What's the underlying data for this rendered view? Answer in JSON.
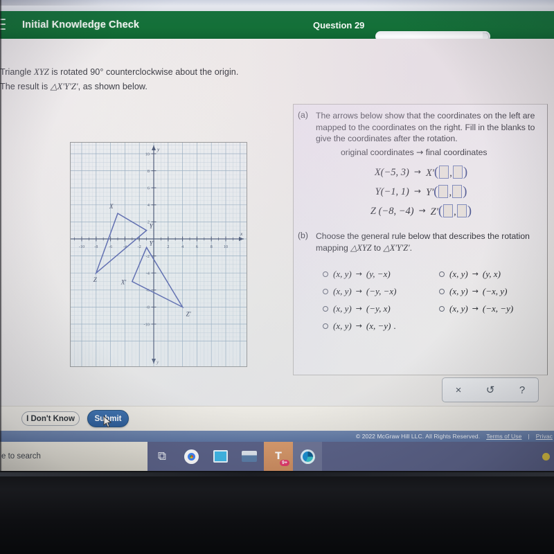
{
  "header": {
    "menu_icon": "hamburger-icon",
    "title": "Initial Knowledge Check",
    "question_label": "Question 29",
    "progress_percent": 97,
    "brand_green": "#147038"
  },
  "prompt": {
    "line1_a": "Triangle ",
    "line1_math": "XYZ",
    "line1_b": " is rotated 90° counterclockwise about the origin.",
    "line2_a": "The result is ",
    "line2_math": "△X'Y'Z'",
    "line2_b": ", as shown below."
  },
  "graph": {
    "x_ticks": [
      -10,
      -8,
      -6,
      -4,
      -2,
      2,
      4,
      6,
      8,
      10
    ],
    "y_ticks": [
      10,
      8,
      6,
      4,
      2,
      -2,
      -4,
      -6,
      -8,
      -10
    ],
    "x_axis_label": "x",
    "y_axis_label": "y",
    "grid": true,
    "axis_range_x": [
      -11.5,
      11.5
    ],
    "axis_range_y": [
      -11.5,
      11.5
    ],
    "preimage": {
      "name": "XYZ",
      "points": [
        {
          "label": "X",
          "x": -5,
          "y": 3
        },
        {
          "label": "Y",
          "x": -1,
          "y": 1
        },
        {
          "label": "Z",
          "x": -8,
          "y": -4
        }
      ]
    },
    "image": {
      "name": "X'Y'Z'",
      "points": [
        {
          "label": "X'",
          "x": -3,
          "y": -5
        },
        {
          "label": "Y'",
          "x": -1,
          "y": -1
        },
        {
          "label": "Z'",
          "x": 4,
          "y": -8
        }
      ]
    },
    "stroke_color": "#4f5fa8"
  },
  "part_a": {
    "label": "(a)",
    "text": "The arrows below show that the coordinates on the left are mapped to the coordinates on the right. Fill in the blanks to give the coordinates after the rotation.",
    "columns_caption_left": "original coordinates",
    "columns_caption_arrow": "→",
    "columns_caption_right": "final coordinates",
    "mappings": [
      {
        "source": "X(−5, 3)",
        "target_prefix": "X'",
        "blank1": "",
        "blank2": ""
      },
      {
        "source": "Y(−1, 1)",
        "target_prefix": "Y'",
        "blank1": "",
        "blank2": ""
      },
      {
        "source": "Z (−8, −4)",
        "target_prefix": "Z'",
        "blank1": "",
        "blank2": ""
      }
    ]
  },
  "part_b": {
    "label": "(b)",
    "text_line1": "Choose the general rule below that describes the rotation",
    "text_line2_a": "mapping ",
    "text_line2_math1": "△XYZ",
    "text_line2_b": " to ",
    "text_line2_math2": "△X'Y'Z'",
    "text_line2_c": ".",
    "options_left": [
      {
        "from": "(x, y)",
        "to": "(y, −x)",
        "selected": false
      },
      {
        "from": "(x, y)",
        "to": "(−y, −x)",
        "selected": false
      },
      {
        "from": "(x, y)",
        "to": "(−y, x)",
        "selected": false
      },
      {
        "from": "(x, y)",
        "to": "(x, −y)",
        "selected": false,
        "trailing": "."
      }
    ],
    "options_right": [
      {
        "from": "(x, y)",
        "to": "(y, x)",
        "selected": false
      },
      {
        "from": "(x, y)",
        "to": "(−x, y)",
        "selected": false
      },
      {
        "from": "(x, y)",
        "to": "(−x, −y)",
        "selected": false
      }
    ]
  },
  "tools": {
    "clear_icon": "×",
    "undo_icon": "↺",
    "help_icon": "?"
  },
  "actions": {
    "dont_know_label": "I Don't Know",
    "submit_label": "Submit",
    "submit_color": "#2d5d99"
  },
  "footer": {
    "copyright": "© 2022 McGraw Hill LLC. All Rights Reserved.",
    "terms": "Terms of Use",
    "separator": "|",
    "privacy": "Privac"
  },
  "taskbar": {
    "search_text": "e to search",
    "items": [
      {
        "name": "task-view-icon",
        "glyph": "⧉"
      },
      {
        "name": "chrome-icon",
        "glyph": "●"
      },
      {
        "name": "remote-desktop-icon",
        "glyph": "▣"
      },
      {
        "name": "printer-app-icon",
        "glyph": "☰"
      },
      {
        "name": "teams-icon",
        "glyph": "T",
        "badge": "9+"
      },
      {
        "name": "edge-icon",
        "glyph": "◔"
      }
    ],
    "tray_dot_color": "#e4c93f"
  }
}
